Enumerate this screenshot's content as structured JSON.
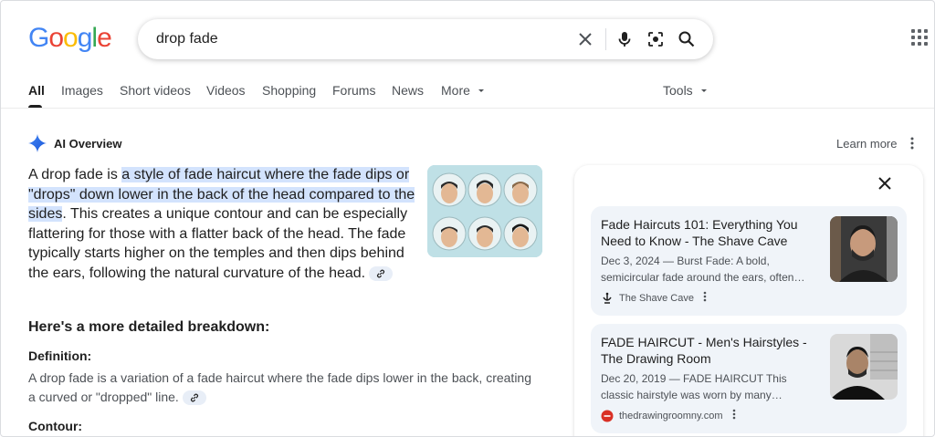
{
  "header": {
    "logo": "Google",
    "search_query": "drop fade"
  },
  "tabs": [
    {
      "label": "All",
      "active": true
    },
    {
      "label": "Images"
    },
    {
      "label": "Short videos"
    },
    {
      "label": "Videos"
    },
    {
      "label": "Shopping"
    },
    {
      "label": "Forums"
    },
    {
      "label": "News"
    },
    {
      "label": "More"
    }
  ],
  "tools_label": "Tools",
  "ai_overview": {
    "title": "AI Overview",
    "learn_more": "Learn more",
    "intro_before": "A drop fade is ",
    "intro_highlight": "a style of fade haircut where the fade dips or \"drops\" down lower in the back of the head compared to the sides",
    "intro_after": ". This creates a unique contour and can be especially flattering for those with a flatter back of the head. The fade typically starts higher on the temples and then dips behind the ears, following the natural curvature of the head.",
    "breakdown_heading": "Here's a more detailed breakdown:",
    "definition_title": "Definition:",
    "definition_text": "A drop fade is a variation of a fade haircut where the fade dips lower in the back, creating a curved or \"dropped\" line.",
    "contour_title": "Contour:"
  },
  "sources": [
    {
      "title": "Fade Haircuts 101: Everything You Need to Know - The Shave Cave",
      "snippet": "Dec 3, 2024 — Burst Fade: A bold, semicircular fade around the ears, often…",
      "source_name": "The Shave Cave"
    },
    {
      "title": "FADE HAIRCUT - Men's Hairstyles - The Drawing Room",
      "snippet": "Dec 20, 2019 — FADE HAIRCUT This classic hairstyle was worn by many…",
      "source_name": "thedrawingroomny.com"
    }
  ],
  "colors": {
    "highlight": "#d3e3fd",
    "panel_card": "#f0f4f9",
    "text_secondary": "#4d5156"
  }
}
